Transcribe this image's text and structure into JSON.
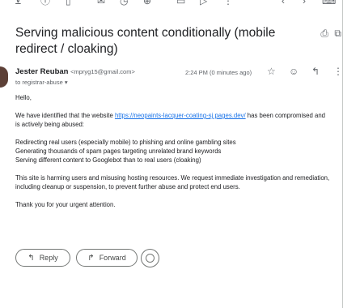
{
  "toolbar": {
    "icons": [
      "archive-icon",
      "report-spam-icon",
      "delete-icon",
      "mark-unread-icon",
      "snooze-icon",
      "add-task-icon",
      "move-to-icon",
      "label-icon",
      "more-vert-icon",
      "prev-icon",
      "next-icon",
      "keyboard-icon"
    ]
  },
  "email": {
    "subject": "Serving malicious content conditionally (mobile redirect / cloaking)",
    "sender_name": "Jester Reuban",
    "sender_email": "<mpryg15@gmail.com>",
    "to": "to registrar-abuse",
    "time": "2:24 PM (0 minutes ago)",
    "greeting": "Hello,",
    "p1_before": "We have identified that the website ",
    "p1_link": "https://neopaints-lacquer-coating-sj.pages.dev/",
    "p1_after": " has been compromised and is actively being abused:",
    "list": [
      "Redirecting real users (especially mobile) to phishing and online gambling sites",
      "Generating thousands of spam pages targeting unrelated brand keywords",
      "Serving different content to Googlebot than to real users (cloaking)"
    ],
    "p3": "This site is harming users and misusing hosting resources. We request immediate investigation and remediation, including cleanup or suspension, to prevent further abuse and protect end users.",
    "closing": "Thank you for your urgent attention."
  },
  "actions": {
    "reply": "Reply",
    "forward": "Forward"
  }
}
